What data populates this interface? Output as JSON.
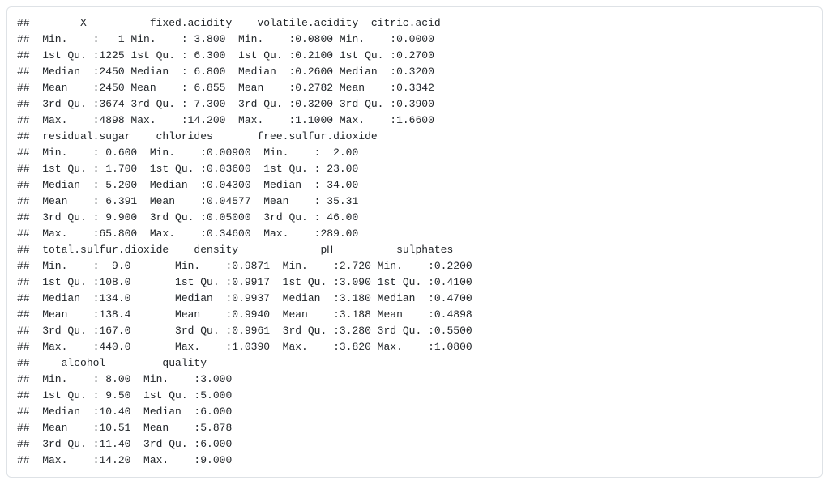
{
  "prefix": "## ",
  "headerRows": [
    [
      "X",
      "fixed.acidity",
      "volatile.acidity",
      "citric.acid"
    ],
    [
      "residual.sugar",
      "chlorides",
      "free.sulfur.dioxide"
    ],
    [
      "total.sulfur.dioxide",
      "density",
      "pH",
      "sulphates"
    ],
    [
      "alcohol",
      "quality"
    ]
  ],
  "stats": [
    "Min.",
    "1st Qu.",
    "Median",
    "Mean",
    "3rd Qu.",
    "Max."
  ],
  "columns": {
    "X": {
      "Min.": "   1",
      "1st Qu.": "1225",
      "Median": "2450",
      "Mean": "2450",
      "3rd Qu.": "3674",
      "Max.": "4898"
    },
    "fixed.acidity": {
      "Min.": " 3.800",
      "1st Qu.": " 6.300",
      "Median": " 6.800",
      "Mean": " 6.855",
      "3rd Qu.": " 7.300",
      "Max.": "14.200"
    },
    "volatile.acidity": {
      "Min.": "0.0800",
      "1st Qu.": "0.2100",
      "Median": "0.2600",
      "Mean": "0.2782",
      "3rd Qu.": "0.3200",
      "Max.": "1.1000"
    },
    "citric.acid": {
      "Min.": "0.0000",
      "1st Qu.": "0.2700",
      "Median": "0.3200",
      "Mean": "0.3342",
      "3rd Qu.": "0.3900",
      "Max.": "1.6600"
    },
    "residual.sugar": {
      "Min.": " 0.600",
      "1st Qu.": " 1.700",
      "Median": " 5.200",
      "Mean": " 6.391",
      "3rd Qu.": " 9.900",
      "Max.": "65.800"
    },
    "chlorides": {
      "Min.": "0.00900",
      "1st Qu.": "0.03600",
      "Median": "0.04300",
      "Mean": "0.04577",
      "3rd Qu.": "0.05000",
      "Max.": "0.34600"
    },
    "free.sulfur.dioxide": {
      "Min.": "  2.00",
      "1st Qu.": " 23.00",
      "Median": " 34.00",
      "Mean": " 35.31",
      "3rd Qu.": " 46.00",
      "Max.": "289.00"
    },
    "total.sulfur.dioxide": {
      "Min.": "  9.0",
      "1st Qu.": "108.0",
      "Median": "134.0",
      "Mean": "138.4",
      "3rd Qu.": "167.0",
      "Max.": "440.0"
    },
    "density": {
      "Min.": "0.9871",
      "1st Qu.": "0.9917",
      "Median": "0.9937",
      "Mean": "0.9940",
      "3rd Qu.": "0.9961",
      "Max.": "1.0390"
    },
    "pH": {
      "Min.": "2.720",
      "1st Qu.": "3.090",
      "Median": "3.180",
      "Mean": "3.188",
      "3rd Qu.": "3.280",
      "Max.": "3.820"
    },
    "sulphates": {
      "Min.": "0.2200",
      "1st Qu.": "0.4100",
      "Median": "0.4700",
      "Mean": "0.4898",
      "3rd Qu.": "0.5500",
      "Max.": "1.0800"
    },
    "alcohol": {
      "Min.": " 8.00",
      "1st Qu.": " 9.50",
      "Median": "10.40",
      "Mean": "10.51",
      "3rd Qu.": "11.40",
      "Max.": "14.20"
    },
    "quality": {
      "Min.": "3.000",
      "1st Qu.": "5.000",
      "Median": "6.000",
      "Mean": "5.878",
      "3rd Qu.": "6.000",
      "Max.": "9.000"
    }
  },
  "layout": {
    "groups": [
      {
        "headerLine": "       X          fixed.acidity    volatile.acidity  citric.acid     ",
        "cells": [
          {
            "col": "X",
            "labelWidth": 8,
            "width": 14
          },
          {
            "col": "fixed.acidity",
            "labelWidth": 8,
            "width": 17
          },
          {
            "col": "volatile.acidity",
            "labelWidth": 8,
            "width": 16
          },
          {
            "col": "citric.acid",
            "labelWidth": 8,
            "width": 16
          }
        ]
      },
      {
        "headerLine": " residual.sugar    chlorides       free.sulfur.dioxide",
        "cells": [
          {
            "col": "residual.sugar",
            "labelWidth": 8,
            "width": 17
          },
          {
            "col": "chlorides",
            "labelWidth": 8,
            "width": 18
          },
          {
            "col": "free.sulfur.dioxide",
            "labelWidth": 8,
            "width": 16
          }
        ]
      },
      {
        "headerLine": " total.sulfur.dioxide    density             pH          sulphates     ",
        "cells": [
          {
            "col": "total.sulfur.dioxide",
            "labelWidth": 8,
            "width": 21
          },
          {
            "col": "density",
            "labelWidth": 8,
            "width": 17
          },
          {
            "col": "pH",
            "labelWidth": 8,
            "width": 15
          },
          {
            "col": "sulphates",
            "labelWidth": 8,
            "width": 16
          }
        ]
      },
      {
        "headerLine": "    alcohol         quality     ",
        "cells": [
          {
            "col": "alcohol",
            "labelWidth": 8,
            "width": 16
          },
          {
            "col": "quality",
            "labelWidth": 8,
            "width": 14
          }
        ]
      }
    ]
  }
}
